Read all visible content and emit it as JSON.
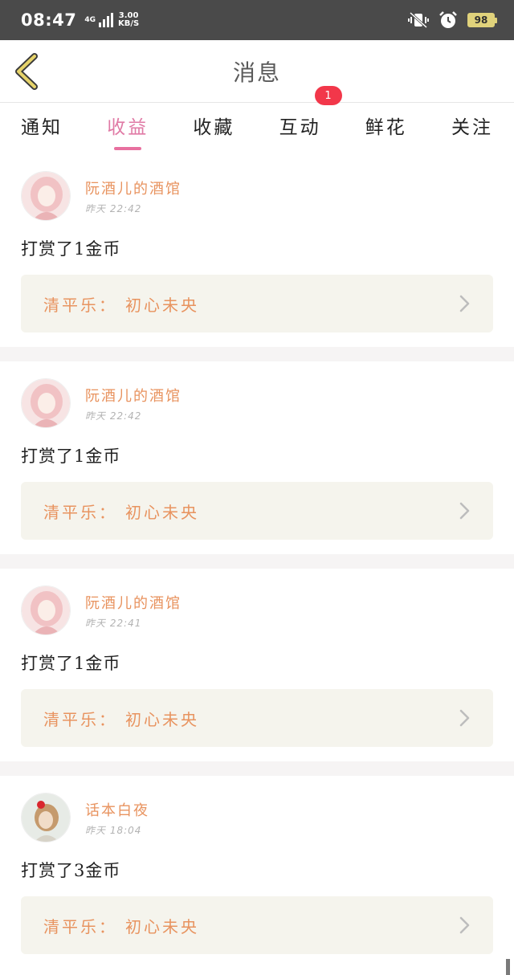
{
  "status_bar": {
    "time": "08:47",
    "network": "4G",
    "speed_value": "3.00",
    "speed_unit": "KB/S",
    "battery": "98",
    "icons": [
      "vibrate-mute-icon",
      "alarm-icon",
      "battery-icon"
    ]
  },
  "header": {
    "title": "消息",
    "back_icon": "chevron-left-icon"
  },
  "tabs": [
    {
      "label": "通知"
    },
    {
      "label": "收益",
      "active": true
    },
    {
      "label": "收藏"
    },
    {
      "label": "互动",
      "badge": "1"
    },
    {
      "label": "鲜花"
    },
    {
      "label": "关注"
    }
  ],
  "messages": [
    {
      "user": "阮酒儿的酒馆",
      "time": "昨天 22:42",
      "reward": "打赏了1金币",
      "work_label": "清平乐：",
      "work_name": "初心未央"
    },
    {
      "user": "阮酒儿的酒馆",
      "time": "昨天 22:42",
      "reward": "打赏了1金币",
      "work_label": "清平乐：",
      "work_name": "初心未央"
    },
    {
      "user": "阮酒儿的酒馆",
      "time": "昨天 22:41",
      "reward": "打赏了1金币",
      "work_label": "清平乐：",
      "work_name": "初心未央"
    },
    {
      "user": "话本白夜",
      "time": "昨天 18:04",
      "reward": "打赏了3金币",
      "work_label": "清平乐：",
      "work_name": "初心未央"
    }
  ],
  "colors": {
    "accent_pink": "#e8709f",
    "username_orange": "#e8935f",
    "badge_red": "#f2374a",
    "card_bg": "#f5f4ed",
    "back_arrow_yellow": "#e6d36a"
  }
}
